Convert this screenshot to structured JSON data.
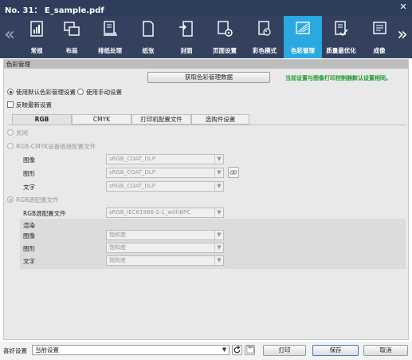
{
  "window": {
    "title": "No. 31： E_sample.pdf",
    "close_glyph": "✕"
  },
  "toolbar": {
    "prev_glyph": "«",
    "next_glyph": "»",
    "items": [
      {
        "label": "常规",
        "icon": "general-icon"
      },
      {
        "label": "布局",
        "icon": "layout-icon"
      },
      {
        "label": "排纸处理",
        "icon": "output-icon"
      },
      {
        "label": "纸张",
        "icon": "paper-icon"
      },
      {
        "label": "封面",
        "icon": "cover-icon"
      },
      {
        "label": "页面设置",
        "icon": "page-setup-icon"
      },
      {
        "label": "彩色模式",
        "icon": "color-mode-icon"
      },
      {
        "label": "色彩管理",
        "icon": "color-management-icon",
        "active": true
      },
      {
        "label": "质量最优化",
        "icon": "quality-icon"
      },
      {
        "label": "成像",
        "icon": "imaging-icon"
      }
    ]
  },
  "color_mgmt": {
    "section_title": "色彩管理",
    "get_info_button": "获取色彩管理数据",
    "note": "当前设置与图像打印控制器默认设置相同。",
    "radio_default": "使用默认色彩管理设置",
    "radio_manual": "使用手动设置",
    "reflect_latest": "反映最新设置",
    "tabs": [
      "RGB",
      "CMYK",
      "打印机配置文件",
      "选购件设置"
    ],
    "rgb": {
      "off": "关闭",
      "link_profile": "RGB-CMYK设备链接配置文件",
      "rows_link": [
        {
          "label": "图像",
          "value": "sRGB_COAT_DLP"
        },
        {
          "label": "图形",
          "value": "sRGB_COAT_DLP"
        },
        {
          "label": "文字",
          "value": "sRGB_COAT_DLP"
        }
      ],
      "source_profile": "RGB源配置文件",
      "source_label": "RGB源配置文件",
      "source_value": "sRGB_IEC61966-2-1_withBPC",
      "render_title": "渲染",
      "rows_render": [
        {
          "label": "图像",
          "value": "饱和度"
        },
        {
          "label": "图形",
          "value": "饱和度"
        },
        {
          "label": "文字",
          "value": "饱和度"
        }
      ]
    }
  },
  "footer": {
    "pref_label": "喜好设置",
    "pref_value": "当前设置",
    "print": "打印",
    "save": "保存",
    "cancel": "取消"
  },
  "colors": {
    "titlebar": "#2e3d5c",
    "toolbar": "#33415f",
    "active_tab": "#2aa8e0",
    "note_green": "#1f9a2c"
  }
}
